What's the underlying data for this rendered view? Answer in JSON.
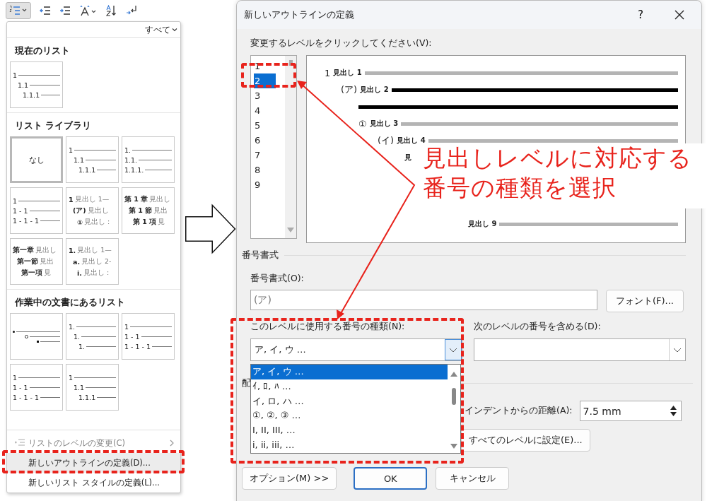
{
  "list_menu": {
    "filter": "すべて",
    "sections": [
      {
        "title": "現在のリスト",
        "items": [
          {
            "kind": "outline",
            "indented": true,
            "selected": false,
            "lines": [
              "1",
              "1.1",
              "1.1.1"
            ]
          }
        ]
      },
      {
        "title": "リスト ライブラリ",
        "items": [
          {
            "kind": "none",
            "selected": true,
            "label": "なし"
          },
          {
            "kind": "outline",
            "indented": true,
            "selected": false,
            "lines": [
              "1",
              "1.1",
              "1.1.1"
            ]
          },
          {
            "kind": "outline",
            "indented": false,
            "selected": false,
            "lines": [
              "1.",
              "1.1.",
              "1.1.1."
            ]
          },
          {
            "kind": "outline",
            "indented": false,
            "selected": false,
            "lines": [
              "1",
              "1 - 1",
              "1 - 1 - 1"
            ]
          },
          {
            "kind": "heading",
            "selected": false,
            "lines": [
              {
                "num": "1",
                "text": "見出し 1—"
              },
              {
                "num": "(ア)",
                "text": "見出し"
              },
              {
                "num": "①",
                "text": "見出し :"
              }
            ]
          },
          {
            "kind": "heading",
            "selected": false,
            "lines": [
              {
                "num": "第 1 章",
                "text": "見出し"
              },
              {
                "num": "第 1 節",
                "text": "見出"
              },
              {
                "num": "第 1 項",
                "text": "見"
              }
            ]
          },
          {
            "kind": "heading",
            "selected": false,
            "lines": [
              {
                "num": "第一章",
                "text": "見出し"
              },
              {
                "num": "第一節",
                "text": "見出"
              },
              {
                "num": "第一項",
                "text": "見"
              }
            ]
          },
          {
            "kind": "heading",
            "selected": false,
            "lines": [
              {
                "num": "1.",
                "text": "見出し 1—"
              },
              {
                "num": "a.",
                "text": "見出し 2-"
              },
              {
                "num": "i.",
                "text": "見出し :"
              }
            ]
          }
        ]
      },
      {
        "title": "作業中の文書にあるリスト",
        "items": [
          {
            "kind": "bullets",
            "selected": false
          },
          {
            "kind": "outline",
            "indented": true,
            "selected": false,
            "lines": [
              "1.",
              "1.",
              "1."
            ]
          },
          {
            "kind": "outline",
            "indented": false,
            "selected": false,
            "lines": [
              "1",
              "1 - 1",
              "1 - 1 - 1"
            ]
          },
          {
            "kind": "outline",
            "indented": false,
            "selected": false,
            "lines": [
              "1",
              "1 - 1",
              "1 - 1 - 1"
            ]
          },
          {
            "kind": "outline",
            "indented": true,
            "selected": false,
            "lines": [
              "1",
              "1.1",
              "1.1.1"
            ]
          }
        ]
      }
    ],
    "commands": [
      {
        "label": "リストのレベルの変更(C)",
        "disabled": true,
        "highlighted": false,
        "submenu": true
      },
      {
        "label": "新しいアウトラインの定義(D)...",
        "disabled": false,
        "highlighted": true,
        "submenu": false
      },
      {
        "label": "新しいリスト スタイルの定義(L)...",
        "disabled": false,
        "highlighted": false,
        "submenu": false
      }
    ]
  },
  "dialog": {
    "title": "新しいアウトラインの定義",
    "help": "?",
    "level_prompt": "変更するレベルをクリックしてください(V):",
    "levels": [
      {
        "label": "1",
        "selected": false
      },
      {
        "label": "2",
        "selected": true
      },
      {
        "label": "3",
        "selected": false
      },
      {
        "label": "4",
        "selected": false
      },
      {
        "label": "5",
        "selected": false
      },
      {
        "label": "6",
        "selected": false
      },
      {
        "label": "7",
        "selected": false
      },
      {
        "label": "8",
        "selected": false
      },
      {
        "label": "9",
        "selected": false
      }
    ],
    "preview": [
      {
        "number": "1",
        "text": "見出し 1",
        "selected": false,
        "rule": true
      },
      {
        "number": "(ア)",
        "text": "見出し 2",
        "selected": true,
        "rule": true
      },
      {
        "number": "①",
        "text": "見出し 3",
        "selected": false,
        "rule": true
      },
      {
        "number": "(イ)",
        "text": "見出し 4",
        "selected": false,
        "rule": true
      },
      {
        "text": "見",
        "selected": false,
        "rule": false
      },
      {
        "text": "見出し 9",
        "selected": false,
        "rule": true
      }
    ],
    "number_format": {
      "section": "番号書式",
      "format_label": "番号書式(O):",
      "format_value": "(ア)",
      "font_button": "フォント(F)...",
      "style_label": "このレベルに使用する番号の種類(N):",
      "style_value": "ア, イ, ウ …",
      "include_label": "次のレベルの番号を含める(D):",
      "style_options": [
        {
          "label": "ア, イ, ウ …",
          "selected": true
        },
        {
          "label": "ｲ, ﾛ, ﾊ …",
          "selected": false
        },
        {
          "label": "イ, ロ, ハ …",
          "selected": false
        },
        {
          "label": "①, ②, ③ …",
          "selected": false
        },
        {
          "label": "I, II, III, …",
          "selected": false
        },
        {
          "label": "i, ii, iii, …",
          "selected": false
        }
      ]
    },
    "position": {
      "section": "配",
      "indent_label": "インデントからの距離(A):",
      "indent_value": "7.5 mm",
      "apply_all": "すべてのレベルに設定(E)..."
    },
    "options_button": "オプション(M) >>",
    "ok": "OK",
    "cancel": "キャンセル"
  },
  "callout": {
    "lines": [
      "見出しレベルに対応する",
      "番号の種類を選択"
    ]
  }
}
